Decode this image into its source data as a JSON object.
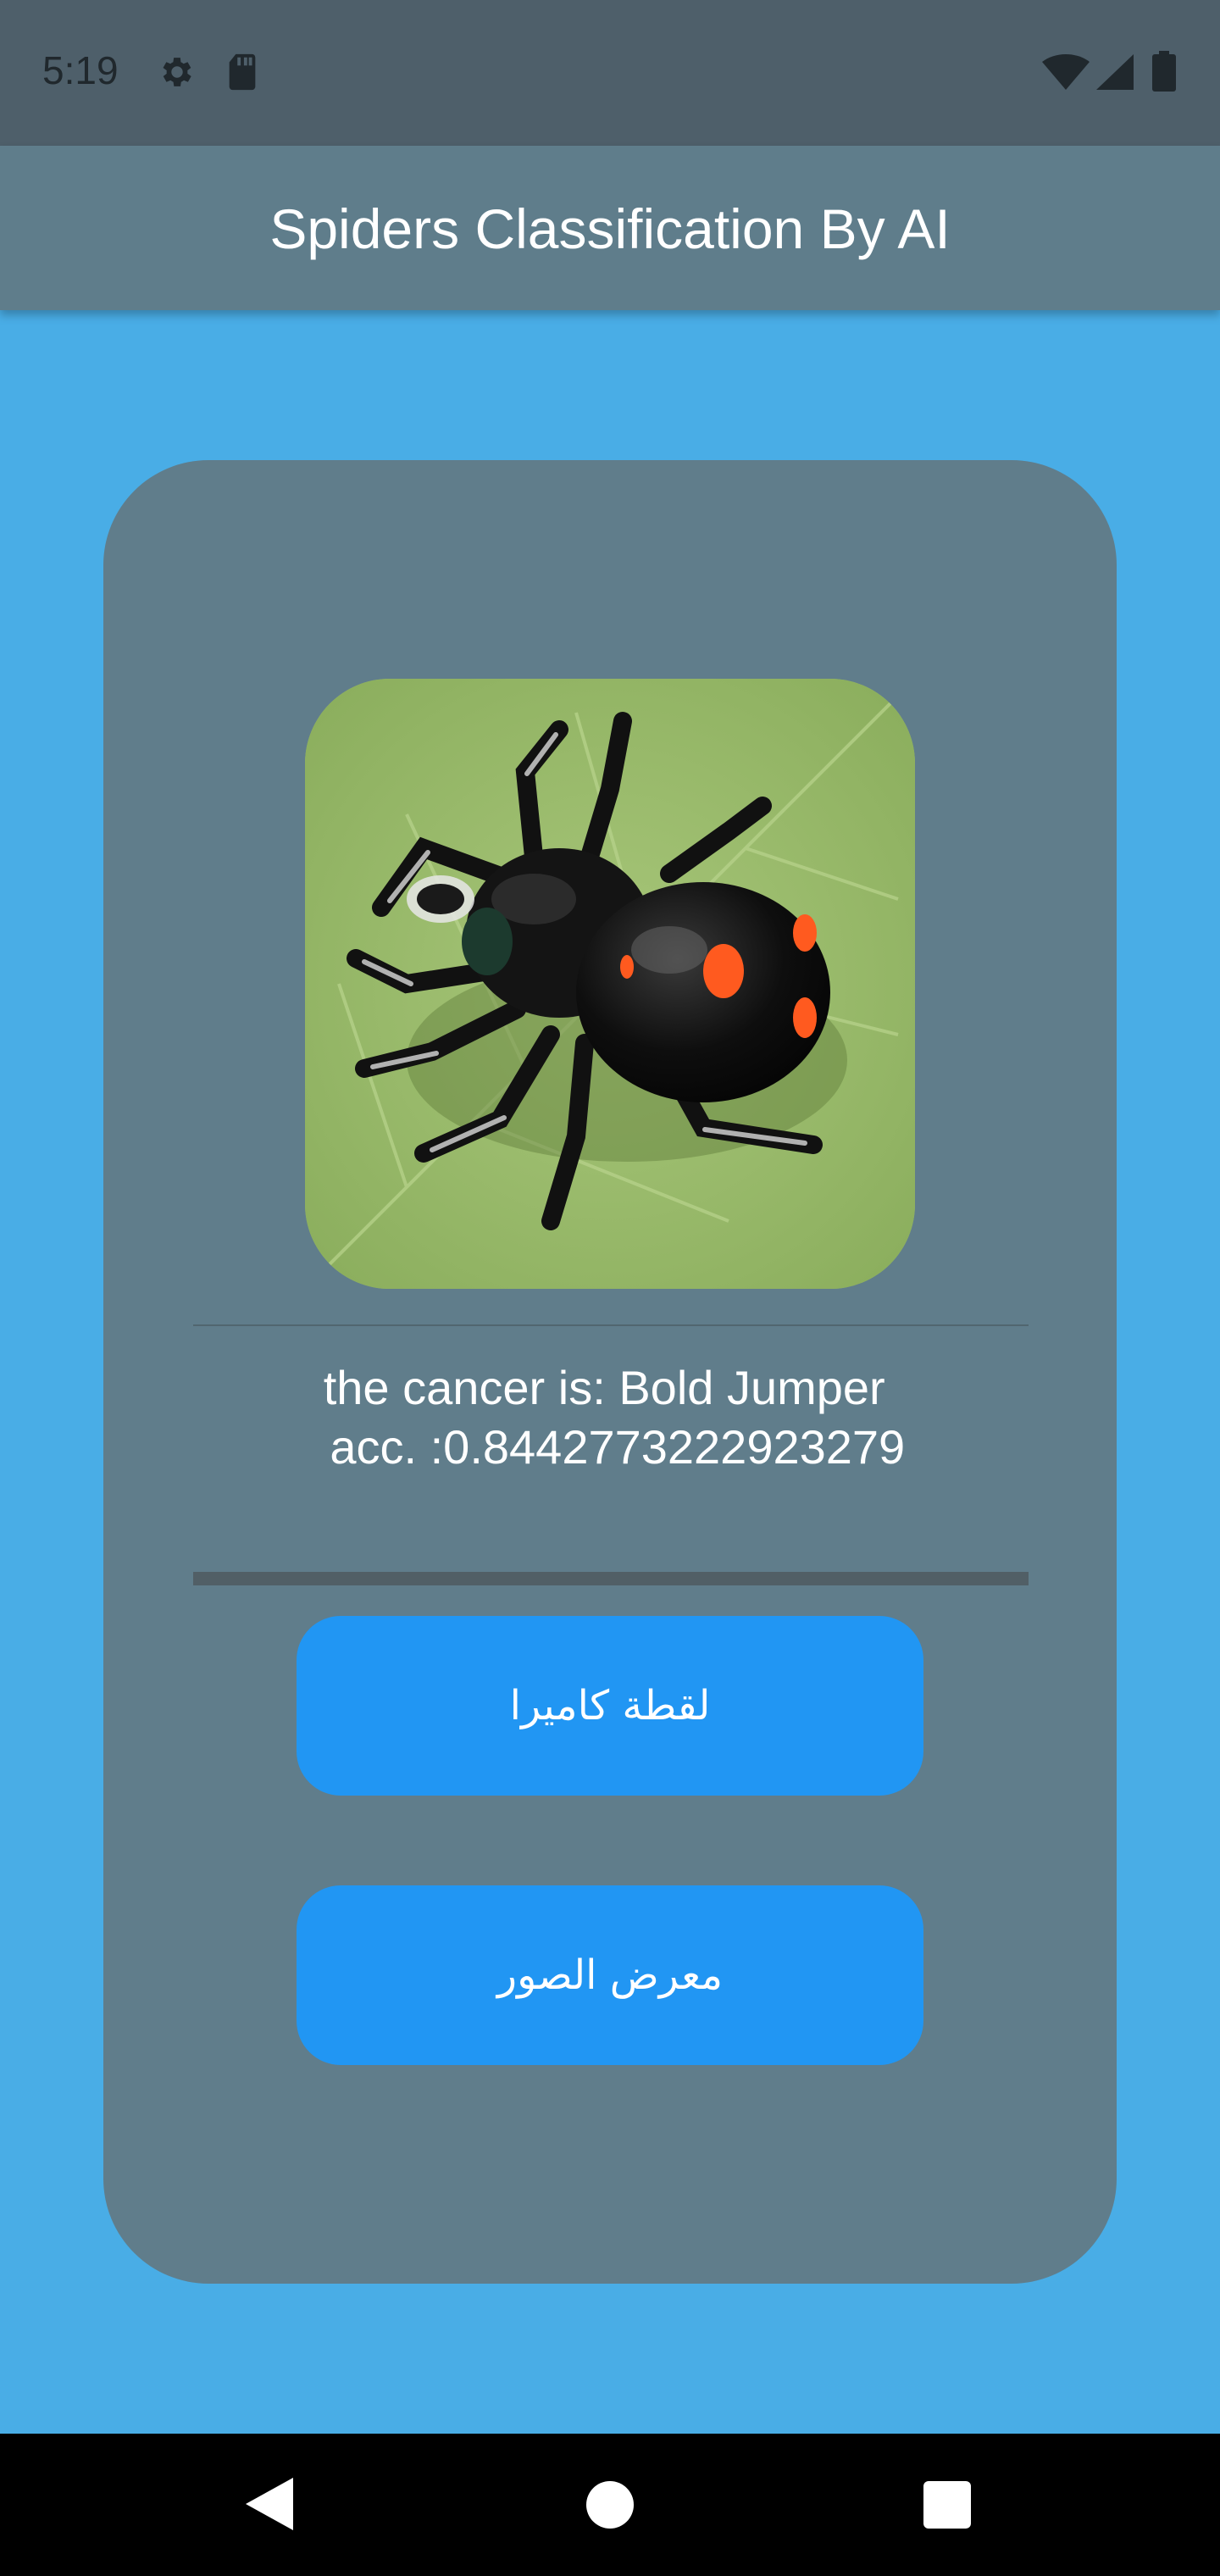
{
  "status_bar": {
    "time": "5:19",
    "icons_left": [
      "gear-icon",
      "sd-card-icon"
    ],
    "icons_right": [
      "wifi-icon",
      "signal-icon",
      "battery-icon"
    ]
  },
  "app_bar": {
    "title": "Spiders Classification By AI"
  },
  "card": {
    "image": "spider-photo",
    "result_line1": "the cancer is: Bold Jumper ",
    "result_line2": " acc. :0.8442773222923279",
    "camera_button": "لقطة كاميرا",
    "gallery_button": "معرض الصور"
  },
  "nav_bar": {
    "icons": [
      "back-icon",
      "home-icon",
      "recents-icon"
    ]
  },
  "colors": {
    "background": "#49ade6",
    "status_bar": "#4e5f6a",
    "app_bar": "#5f7d8b",
    "card": "#607d8b",
    "button": "#2196f3"
  }
}
